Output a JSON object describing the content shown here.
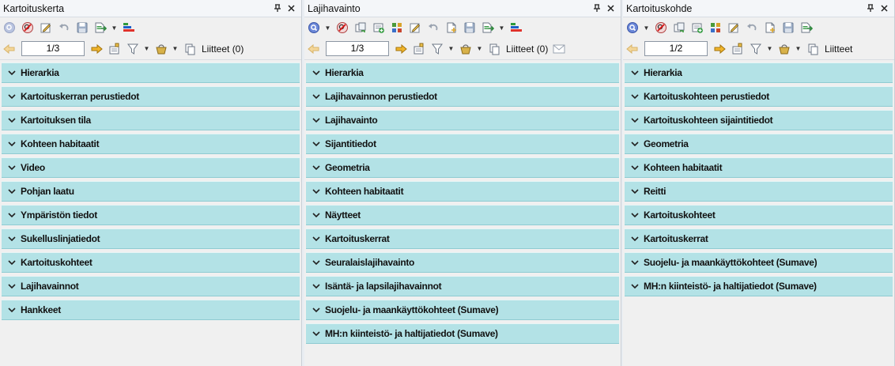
{
  "colors": {
    "section_bg": "#b3e2e6",
    "pane_bg": "#f0f0f0",
    "title_bg": "#f4f6f9"
  },
  "panes": [
    {
      "title": "Kartoituskerta",
      "pin_icon": "pin-icon",
      "close_icon": "close-icon",
      "pager": "1/3",
      "attachments": "Liitteet (0)",
      "toolbar_icons": [
        "search-icon",
        "clear-search-icon",
        "edit-icon",
        "undo-icon",
        "save-icon",
        "export-icon",
        "chart-icon"
      ],
      "sections": [
        "Hierarkia",
        "Kartoituskerran perustiedot",
        "Kartoituksen tila",
        "Kohteen habitaatit",
        "Video",
        "Pohjan laatu",
        "Ympäristön tiedot",
        "Sukelluslinjatiedot",
        "Kartoituskohteet",
        "Lajihavainnot",
        "Hankkeet"
      ]
    },
    {
      "title": "Lajihavainto",
      "pin_icon": "pin-icon",
      "close_icon": "close-icon",
      "pager": "1/3",
      "attachments": "Liitteet (0)",
      "toolbar_icons": [
        "search-icon",
        "clear-search-icon",
        "copy-icon",
        "add-icon",
        "grid-icon",
        "edit-icon",
        "undo-icon",
        "new-icon",
        "save-icon",
        "export-icon",
        "chart-icon"
      ],
      "sections": [
        "Hierarkia",
        "Lajihavainnon perustiedot",
        "Lajihavainto",
        "Sijantitiedot",
        "Geometria",
        "Kohteen habitaatit",
        "Näytteet",
        "Kartoituskerrat",
        "Seuralaislajihavainto",
        "Isäntä- ja lapsilajihavainnot",
        "Suojelu- ja maankäyttökohteet (Sumave)",
        "MH:n kiinteistö- ja haltijatiedot (Sumave)"
      ]
    },
    {
      "title": "Kartoituskohde",
      "pin_icon": "pin-icon",
      "close_icon": "close-icon",
      "pager": "1/2",
      "attachments": "Liitteet",
      "toolbar_icons": [
        "search-icon",
        "clear-search-icon",
        "copy-icon",
        "add-icon",
        "grid-icon",
        "edit-icon",
        "undo-icon",
        "new-icon",
        "save-icon",
        "export-icon"
      ],
      "sections": [
        "Hierarkia",
        "Kartoituskohteen perustiedot",
        "Kartoituskohteen sijaintitiedot",
        "Geometria",
        "Kohteen habitaatit",
        "Reitti",
        "Kartoituskohteet",
        "Kartoituskerrat",
        "Suojelu- ja maankäyttökohteet (Sumave)",
        "MH:n kiinteistö- ja haltijatiedot (Sumave)"
      ]
    }
  ]
}
